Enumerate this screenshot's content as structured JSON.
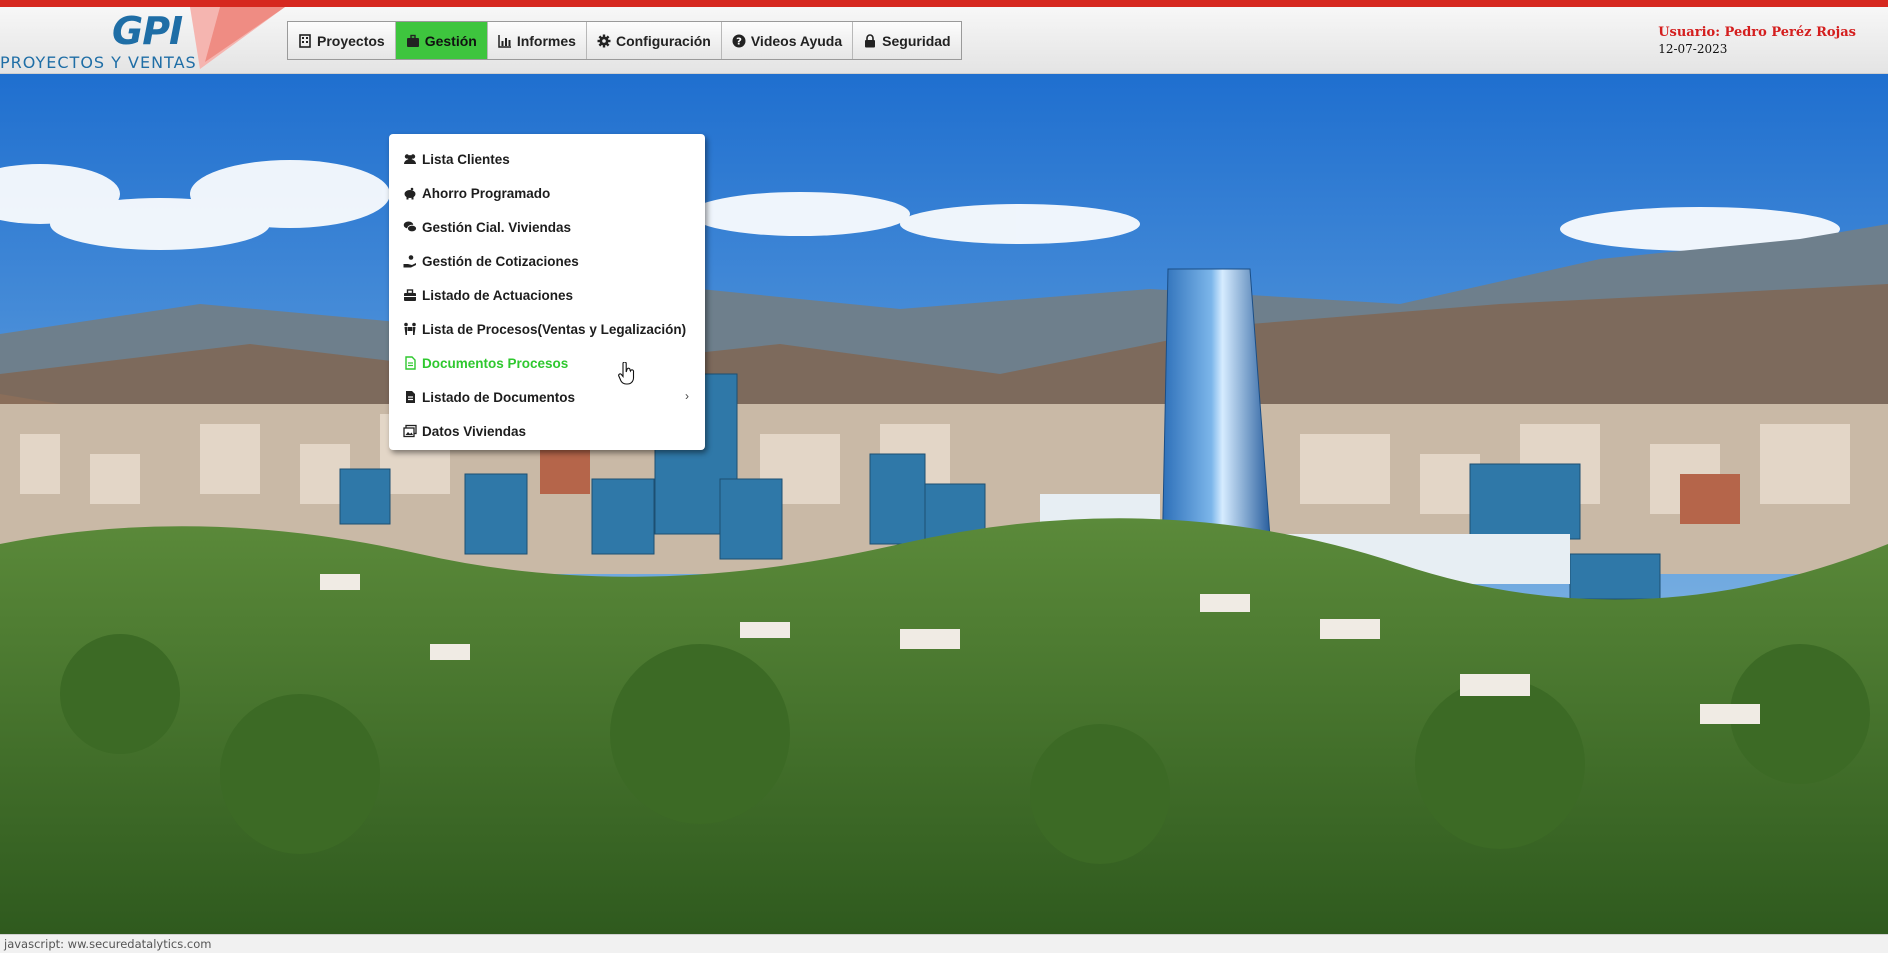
{
  "logo": {
    "name": "GPI",
    "subtitle": "PROYECTOS Y VENTAS"
  },
  "nav": [
    {
      "label": "Proyectos",
      "icon": "building-icon"
    },
    {
      "label": "Gestión",
      "icon": "briefcase-icon",
      "active": true
    },
    {
      "label": "Informes",
      "icon": "bar-chart-icon"
    },
    {
      "label": "Configuración",
      "icon": "gear-icon"
    },
    {
      "label": "Videos Ayuda",
      "icon": "question-circle-icon"
    },
    {
      "label": "Seguridad",
      "icon": "lock-icon"
    }
  ],
  "user": {
    "label": "Usuario: Pedro Peréz Rojas",
    "date": "12-07-2023"
  },
  "menu": [
    {
      "label": "Lista Clientes",
      "icon": "users-icon"
    },
    {
      "label": "Ahorro Programado",
      "icon": "piggy-bank-icon"
    },
    {
      "label": "Gestión Cial. Viviendas",
      "icon": "comments-icon"
    },
    {
      "label": "Gestión de Cotizaciones",
      "icon": "hand-holding-icon"
    },
    {
      "label": "Listado de Actuaciones",
      "icon": "toolbox-icon"
    },
    {
      "label": "Lista de Procesos(Ventas y Legalización)",
      "icon": "people-carry-icon"
    },
    {
      "label": "Documentos Procesos",
      "icon": "file-icon",
      "highlight": true
    },
    {
      "label": "Listado de Documentos",
      "icon": "file-lines-icon",
      "submenu": true
    },
    {
      "label": "Datos Viviendas",
      "icon": "images-icon"
    }
  ],
  "status": "javascript: ww.securedatalytics.com",
  "colors": {
    "accent_red": "#d6281f",
    "active_green": "#3ec53e",
    "brand_blue": "#1f6ea6",
    "user_red": "#d41e1e"
  }
}
